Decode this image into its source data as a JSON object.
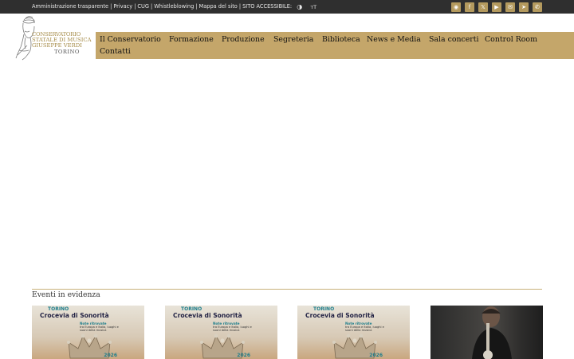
{
  "topbar": {
    "links": [
      "Amministrazione trasparente",
      "Privacy",
      "CUG",
      "Whistleblowing",
      "Mappa del sito",
      "SITO ACCESSIBILE:"
    ],
    "separator": "|",
    "contrast_icon": "◑",
    "textsize_icon": "ᴛT",
    "social_icons": [
      "rss-icon",
      "facebook-icon",
      "x-icon",
      "youtube-icon",
      "mail-icon",
      "telegram-icon",
      "whatsapp-icon"
    ],
    "social_glyphs": [
      "◉",
      "f",
      "𝕏",
      "▶",
      "✉",
      "➤",
      "✆"
    ]
  },
  "logo": {
    "line1": "CONSERVATORIO",
    "line2": "STATALE DI MUSICA",
    "line3": "GIUSEPPE VERDI",
    "line4": "TORINO"
  },
  "nav": {
    "items": [
      "Il Conservatorio",
      "Formazione",
      "Produzione",
      "Segreteria",
      "Biblioteca",
      "News e Media",
      "Sala concerti",
      "Control Room",
      "Contatti"
    ]
  },
  "events": {
    "title": "Eventi in evidenza",
    "poster": {
      "vertical_text": "TORINO",
      "title": "Crocevia di Sonorità",
      "subtitle_head": "Note ritrovate",
      "subtitle_body": "tra Europa e Italia, luoghi e suoni della musica",
      "year": "2026"
    }
  },
  "colors": {
    "accent": "#c4a66a",
    "topbar": "#2f2f2f",
    "logo_gold": "#a48a45",
    "social": "#b49a5e"
  }
}
